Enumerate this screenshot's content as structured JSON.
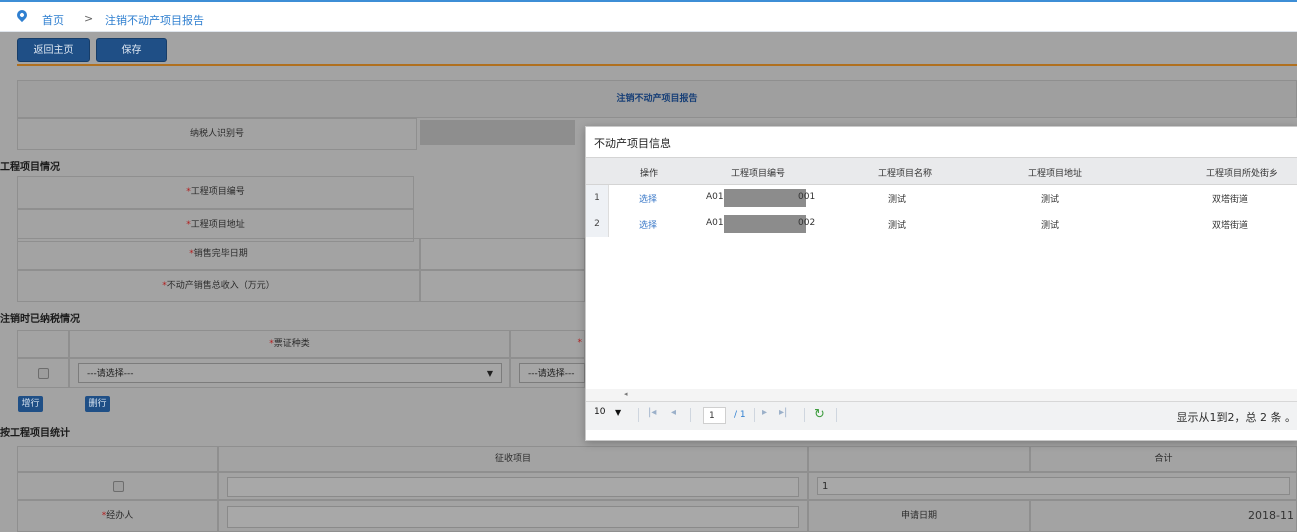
{
  "breadcrumb": {
    "home": "首页",
    "separator": ">",
    "current": "注销不动产项目报告"
  },
  "toolbar": {
    "back_label": "返回主页",
    "save_label": "保存"
  },
  "form": {
    "title": "注销不动产项目报告",
    "taxpayer_id_label": "纳税人识别号",
    "section_project": "工程项目情况",
    "project_no_label": "工程项目编号",
    "project_address_label": "工程项目地址",
    "sale_done_date_label": "销售完毕日期",
    "total_income_label": "不动产销售总收入（万元）",
    "section_tax_paid": "注销时已纳税情况",
    "ticket_type_label": "票证种类",
    "ticket_type_select": "---请选择---",
    "ticket_type_select_2": "---请选择---",
    "add_row_label": "增行",
    "delete_row_label": "删行",
    "section_stats": "按工程项目统计",
    "collect_item_label": "征收项目",
    "total_label": "合计",
    "total_value": "1",
    "agent_label": "经办人",
    "apply_date_label": "申请日期",
    "apply_date_value": "2018-11"
  },
  "dialog": {
    "title": "不动产项目信息",
    "columns": [
      "操作",
      "工程项目编号",
      "工程项目名称",
      "工程项目地址",
      "工程项目所处街乡"
    ],
    "rows": [
      {
        "num": "1",
        "action": "选择",
        "code_prefix": "A01",
        "code_suffix": "001",
        "name": "测试",
        "address": "测试",
        "street": "双塔街道"
      },
      {
        "num": "2",
        "action": "选择",
        "code_prefix": "A01",
        "code_suffix": "002",
        "name": "测试",
        "address": "测试",
        "street": "双塔街道"
      }
    ],
    "pager": {
      "page_size": "10",
      "page_input": "1",
      "page_total": "/ 1",
      "info": "显示从1到2，总 2 条 。"
    }
  }
}
